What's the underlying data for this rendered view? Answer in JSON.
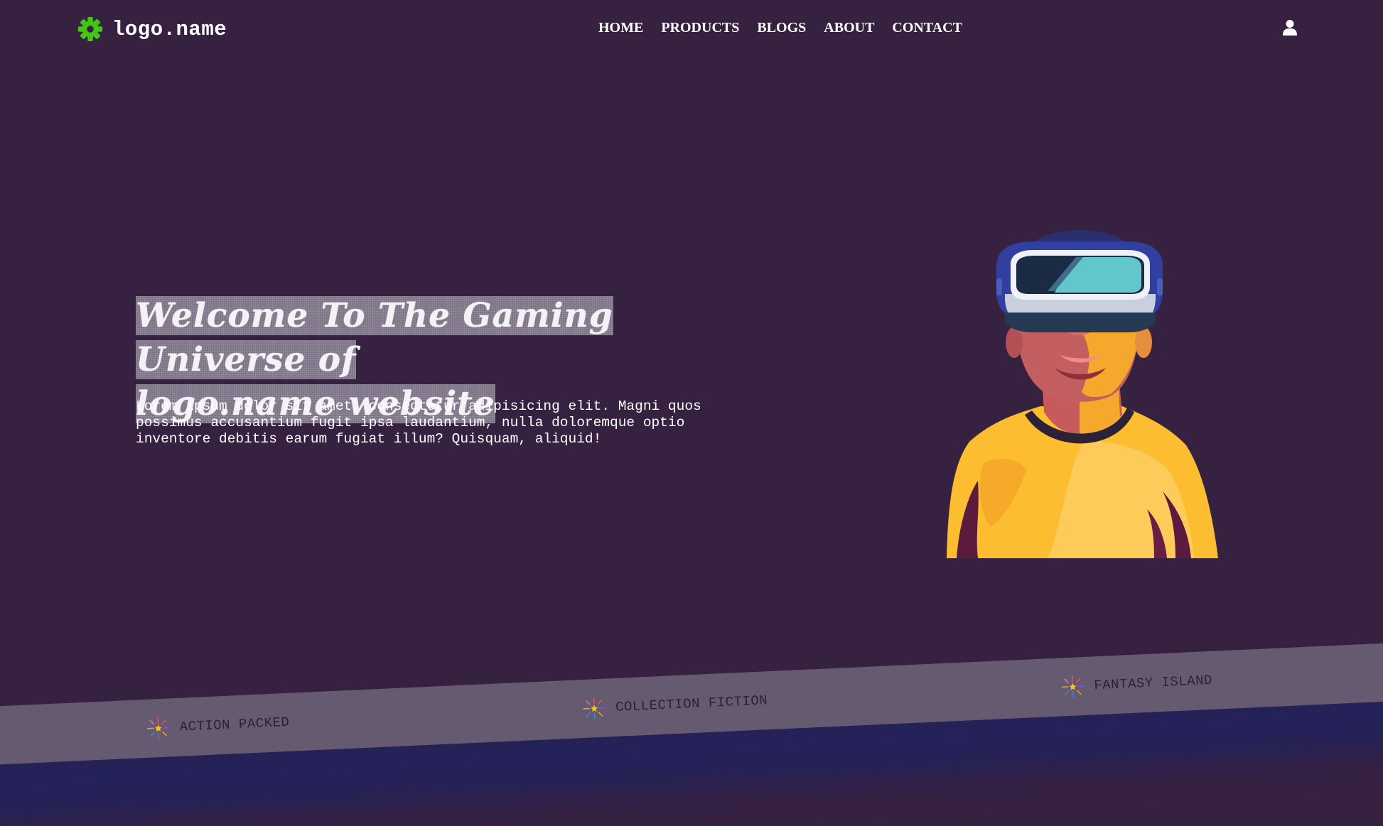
{
  "header": {
    "logo_text": "logo.name",
    "nav": [
      {
        "label": "HOME"
      },
      {
        "label": "PRODUCTS"
      },
      {
        "label": "BLOGS"
      },
      {
        "label": "ABOUT"
      },
      {
        "label": "CONTACT"
      }
    ]
  },
  "hero": {
    "title_line1": "Welcome To The Gaming Universe of",
    "title_line2": "logo.name website",
    "description": "Lorem ipsum dolor sit amet, consectetur adipisicing elit. Magni quos possimus accusantium fugit ipsa laudantium, nulla doloremque optio inventore debitis earum fugiat illum? Quisquam, aliquid!"
  },
  "ticker": {
    "items": [
      {
        "label": "ACTION PACKED"
      },
      {
        "label": "COLLECTION FICTION"
      },
      {
        "label": "FANTASY ISLAND"
      }
    ]
  },
  "colors": {
    "background": "#372141",
    "logo_icon": "#43c515",
    "band": "#655a6f",
    "band_shadow": "#23225a",
    "shirt": "#fcbd31"
  },
  "icons": {
    "logo": "gear-icon",
    "account": "user-icon",
    "ticker": "sparkle-star-icon"
  }
}
